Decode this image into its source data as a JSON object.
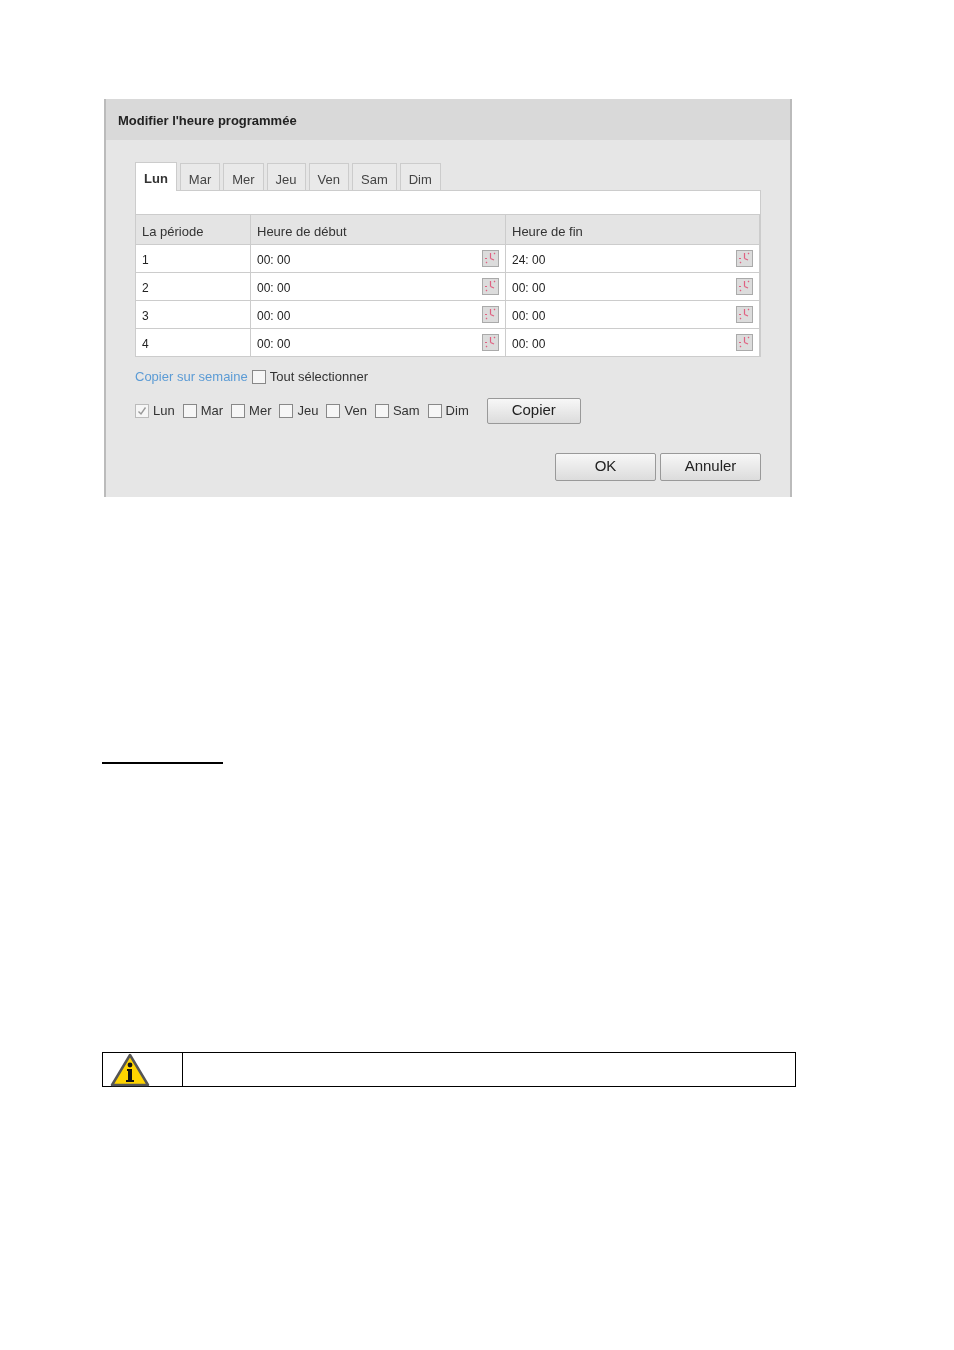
{
  "dialog": {
    "title": "Modifier l'heure programmée",
    "tabs": [
      {
        "label": "Lun",
        "selected": true
      },
      {
        "label": "Mar",
        "selected": false
      },
      {
        "label": "Mer",
        "selected": false
      },
      {
        "label": "Jeu",
        "selected": false
      },
      {
        "label": "Ven",
        "selected": false
      },
      {
        "label": "Sam",
        "selected": false
      },
      {
        "label": "Dim",
        "selected": false
      }
    ],
    "table": {
      "columns": [
        "La période",
        "Heure de début",
        "Heure de fin"
      ],
      "rows": [
        {
          "period": "1",
          "start": "00: 00",
          "end": "24: 00"
        },
        {
          "period": "2",
          "start": "00: 00",
          "end": "00: 00"
        },
        {
          "period": "3",
          "start": "00: 00",
          "end": "00: 00"
        },
        {
          "period": "4",
          "start": "00: 00",
          "end": "00: 00"
        }
      ]
    },
    "copy_link": "Copier sur semaine",
    "select_all": {
      "label": "Tout sélectionner",
      "checked": false
    },
    "days": [
      {
        "label": "Lun",
        "checked": true,
        "disabled": true
      },
      {
        "label": "Mar",
        "checked": false,
        "disabled": false
      },
      {
        "label": "Mer",
        "checked": false,
        "disabled": false
      },
      {
        "label": "Jeu",
        "checked": false,
        "disabled": false
      },
      {
        "label": "Ven",
        "checked": false,
        "disabled": false
      },
      {
        "label": "Sam",
        "checked": false,
        "disabled": false
      },
      {
        "label": "Dim",
        "checked": false,
        "disabled": false
      }
    ],
    "copy_button": "Copier",
    "buttons": [
      "OK",
      "Annuler"
    ]
  }
}
